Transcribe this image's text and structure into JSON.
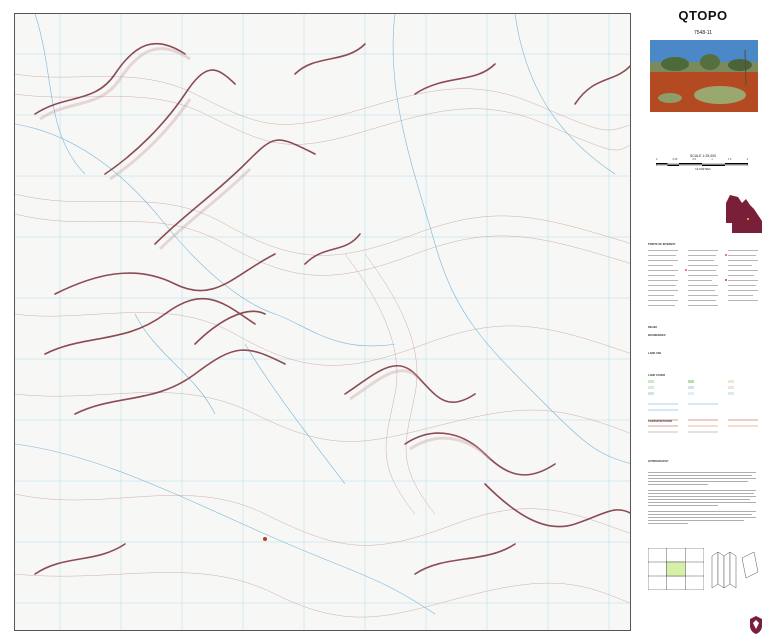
{
  "title": "QTOPO",
  "sheet_number": "7548-11",
  "scale": "SCALE 1:25,000",
  "scale_ticks": [
    "0",
    "0.25",
    "0.5",
    "1",
    "1.5",
    "2"
  ],
  "scale_unit": "KILOMETRES",
  "legend": {
    "points_of_interest": "POINTS OF INTEREST",
    "boundaries": "BOUNDARIES",
    "land_use": "LAND USE",
    "land_cover": "LAND COVER",
    "relief": "RELIEF",
    "hydrography": "HYDROGRAPHY",
    "transportation": "TRANSPORTATION"
  },
  "colors": {
    "contour": "#9a6a6a",
    "cliff": "#7a2e3a",
    "water": "#5aa6d8",
    "grid": "#8fd0e8",
    "map_bg": "#f7f7f5",
    "qld_fill": "#7a1f3a"
  },
  "icons": {
    "photo": "outback-landscape-photo",
    "state_map": "queensland-locator-map",
    "logo": "queensland-government-crest"
  }
}
